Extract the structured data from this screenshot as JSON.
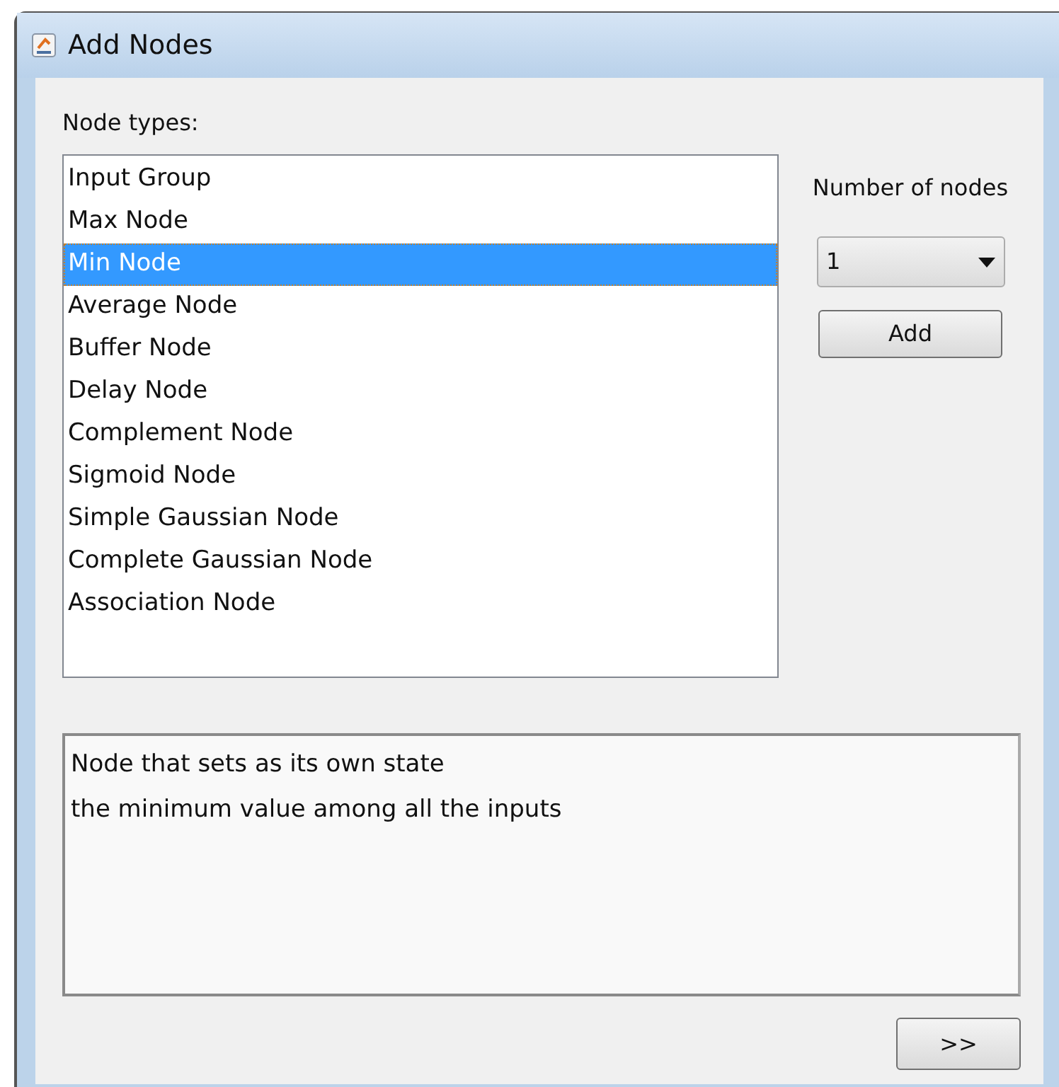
{
  "window": {
    "title": "Add Nodes"
  },
  "node_types": {
    "label": "Node types:",
    "items": [
      {
        "label": "Input Group",
        "selected": false
      },
      {
        "label": "Max Node",
        "selected": false
      },
      {
        "label": "Min Node",
        "selected": true
      },
      {
        "label": "Average Node",
        "selected": false
      },
      {
        "label": "Buffer Node",
        "selected": false
      },
      {
        "label": "Delay Node",
        "selected": false
      },
      {
        "label": "Complement Node",
        "selected": false
      },
      {
        "label": "Sigmoid Node",
        "selected": false
      },
      {
        "label": "Simple Gaussian Node",
        "selected": false
      },
      {
        "label": "Complete Gaussian Node",
        "selected": false
      },
      {
        "label": "Association Node",
        "selected": false
      }
    ]
  },
  "number_of_nodes": {
    "label": "Number of nodes",
    "value": "1"
  },
  "add_button": "Add",
  "description": [
    "Node that sets as its own state",
    "the minimum value among all the inputs"
  ],
  "next_button": ">>"
}
